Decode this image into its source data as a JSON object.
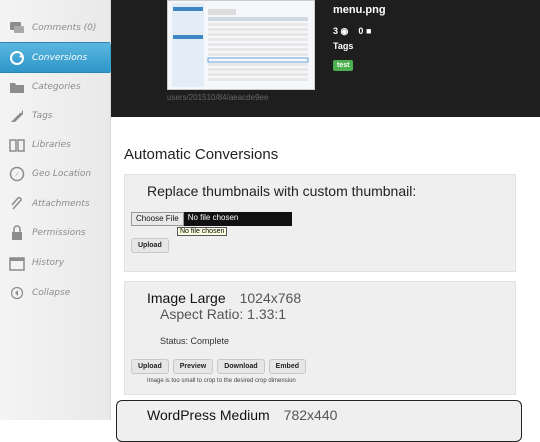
{
  "sidebar": {
    "items": [
      {
        "label": "Comments (0)",
        "icon": "comments-icon",
        "active": false
      },
      {
        "label": "Conversions",
        "icon": "conversions-icon",
        "active": true
      },
      {
        "label": "Categories",
        "icon": "folder-icon",
        "active": false
      },
      {
        "label": "Tags",
        "icon": "tag-icon",
        "active": false
      },
      {
        "label": "Libraries",
        "icon": "libraries-icon",
        "active": false
      },
      {
        "label": "Geo Location",
        "icon": "compass-icon",
        "active": false
      },
      {
        "label": "Attachments",
        "icon": "paperclip-icon",
        "active": false
      },
      {
        "label": "Permissions",
        "icon": "lock-icon",
        "active": false
      },
      {
        "label": "History",
        "icon": "calendar-icon",
        "active": false
      },
      {
        "label": "Collapse",
        "icon": "collapse-icon",
        "active": false
      }
    ]
  },
  "header": {
    "filename": "menu.png",
    "views": "3",
    "comments": "0",
    "tags_label": "Tags",
    "tag": "test",
    "path": "users/201510/84/aeacde9ee"
  },
  "conversions": {
    "title": "Automatic Conversions",
    "replace_title": "Replace thumbnails with custom thumbnail:",
    "choose_file": "Choose File",
    "no_file": "No file chosen",
    "tooltip": "No file chosen",
    "upload": "Upload",
    "image_large": {
      "name": "Image Large",
      "dims": "1024x768",
      "aspect": "Aspect Ratio: 1.33:1",
      "status": "Status: Complete",
      "buttons": [
        "Upload",
        "Preview",
        "Download",
        "Embed"
      ],
      "note": "Image is too small to crop to the desired crop dimension"
    },
    "wordpress_medium": {
      "name": "WordPress Medium",
      "dims": "782x440"
    }
  },
  "colors": {
    "active_nav": "#3aa2d1",
    "header_bg": "#1e1e1e",
    "tag_bg": "#4caf50"
  }
}
